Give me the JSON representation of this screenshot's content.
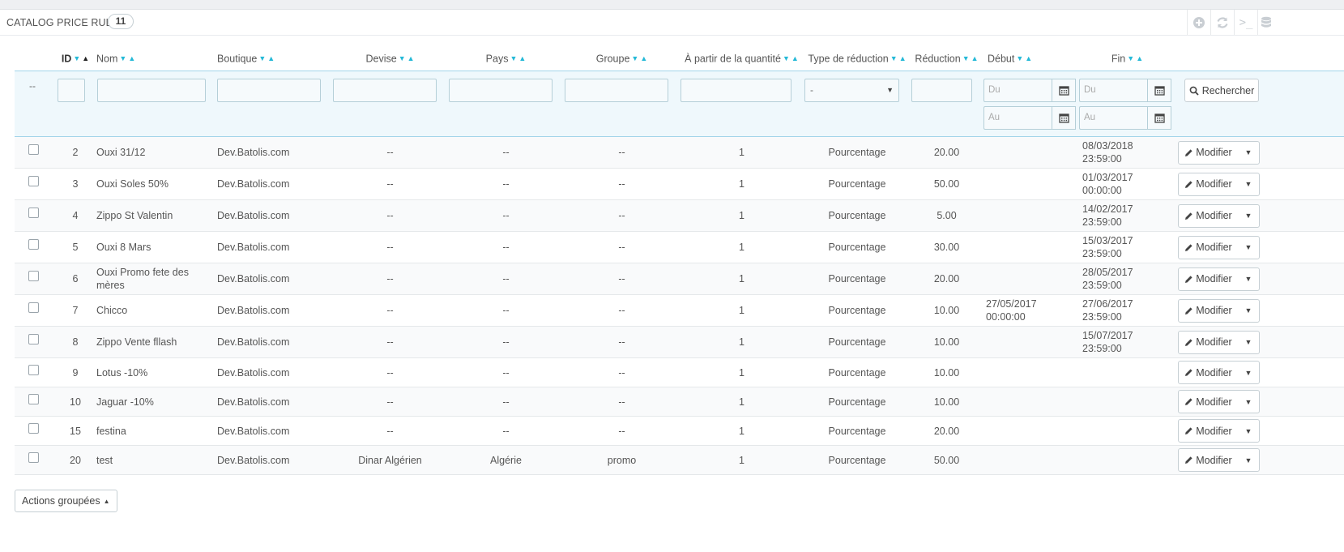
{
  "panel": {
    "title": "Catalog price rules",
    "count": "11"
  },
  "toolbar": {
    "icons": [
      "add-icon",
      "refresh-icon",
      "terminal-icon",
      "database-icon"
    ],
    "terminal_glyph": ">_"
  },
  "columns": {
    "id": "ID",
    "name": "Nom",
    "shop": "Boutique",
    "currency": "Devise",
    "country": "Pays",
    "group": "Groupe",
    "from_quantity": "À partir de la quantité",
    "reduction_type": "Type de réduction",
    "reduction": "Réduction",
    "start": "Début",
    "end": "Fin"
  },
  "filters": {
    "select_all_placeholder": "--",
    "reduction_type_value": "-",
    "date_from_placeholder": "Du",
    "date_to_placeholder": "Au",
    "search_label": "Rechercher"
  },
  "rows": [
    {
      "id": "2",
      "name": "Ouxi 31/12",
      "name2": "",
      "shop": "Dev.Batolis.com",
      "currency": "--",
      "country": "--",
      "group": "--",
      "qty": "1",
      "type": "Pourcentage",
      "reduction": "20.00",
      "start1": "",
      "start2": "",
      "end1": "08/03/2018",
      "end2": "23:59:00"
    },
    {
      "id": "3",
      "name": "Ouxi Soles 50%",
      "name2": "",
      "shop": "Dev.Batolis.com",
      "currency": "--",
      "country": "--",
      "group": "--",
      "qty": "1",
      "type": "Pourcentage",
      "reduction": "50.00",
      "start1": "",
      "start2": "",
      "end1": "01/03/2017",
      "end2": "00:00:00"
    },
    {
      "id": "4",
      "name": "Zippo St Valentin",
      "name2": "",
      "shop": "Dev.Batolis.com",
      "currency": "--",
      "country": "--",
      "group": "--",
      "qty": "1",
      "type": "Pourcentage",
      "reduction": "5.00",
      "start1": "",
      "start2": "",
      "end1": "14/02/2017",
      "end2": "23:59:00"
    },
    {
      "id": "5",
      "name": "Ouxi 8 Mars",
      "name2": "",
      "shop": "Dev.Batolis.com",
      "currency": "--",
      "country": "--",
      "group": "--",
      "qty": "1",
      "type": "Pourcentage",
      "reduction": "30.00",
      "start1": "",
      "start2": "",
      "end1": "15/03/2017",
      "end2": "23:59:00"
    },
    {
      "id": "6",
      "name": "Ouxi Promo fete des",
      "name2": "mères",
      "shop": "Dev.Batolis.com",
      "currency": "--",
      "country": "--",
      "group": "--",
      "qty": "1",
      "type": "Pourcentage",
      "reduction": "20.00",
      "start1": "",
      "start2": "",
      "end1": "28/05/2017",
      "end2": "23:59:00"
    },
    {
      "id": "7",
      "name": "Chicco",
      "name2": "",
      "shop": "Dev.Batolis.com",
      "currency": "--",
      "country": "--",
      "group": "--",
      "qty": "1",
      "type": "Pourcentage",
      "reduction": "10.00",
      "start1": "27/05/2017",
      "start2": "00:00:00",
      "end1": "27/06/2017",
      "end2": "23:59:00"
    },
    {
      "id": "8",
      "name": "Zippo Vente fllash",
      "name2": "",
      "shop": "Dev.Batolis.com",
      "currency": "--",
      "country": "--",
      "group": "--",
      "qty": "1",
      "type": "Pourcentage",
      "reduction": "10.00",
      "start1": "",
      "start2": "",
      "end1": "15/07/2017",
      "end2": "23:59:00"
    },
    {
      "id": "9",
      "name": "Lotus -10%",
      "name2": "",
      "shop": "Dev.Batolis.com",
      "currency": "--",
      "country": "--",
      "group": "--",
      "qty": "1",
      "type": "Pourcentage",
      "reduction": "10.00",
      "start1": "",
      "start2": "",
      "end1": "",
      "end2": ""
    },
    {
      "id": "10",
      "name": "Jaguar -10%",
      "name2": "",
      "shop": "Dev.Batolis.com",
      "currency": "--",
      "country": "--",
      "group": "--",
      "qty": "1",
      "type": "Pourcentage",
      "reduction": "10.00",
      "start1": "",
      "start2": "",
      "end1": "",
      "end2": ""
    },
    {
      "id": "15",
      "name": "festina",
      "name2": "",
      "shop": "Dev.Batolis.com",
      "currency": "--",
      "country": "--",
      "group": "--",
      "qty": "1",
      "type": "Pourcentage",
      "reduction": "20.00",
      "start1": "",
      "start2": "",
      "end1": "",
      "end2": ""
    },
    {
      "id": "20",
      "name": "test",
      "name2": "",
      "shop": "Dev.Batolis.com",
      "currency": "Dinar Algérien",
      "country": "Algérie",
      "group": "promo",
      "qty": "1",
      "type": "Pourcentage",
      "reduction": "50.00",
      "start1": "",
      "start2": "",
      "end1": "",
      "end2": ""
    }
  ],
  "row_action": {
    "label": "Modifier"
  },
  "bulk": {
    "label": "Actions groupées"
  }
}
